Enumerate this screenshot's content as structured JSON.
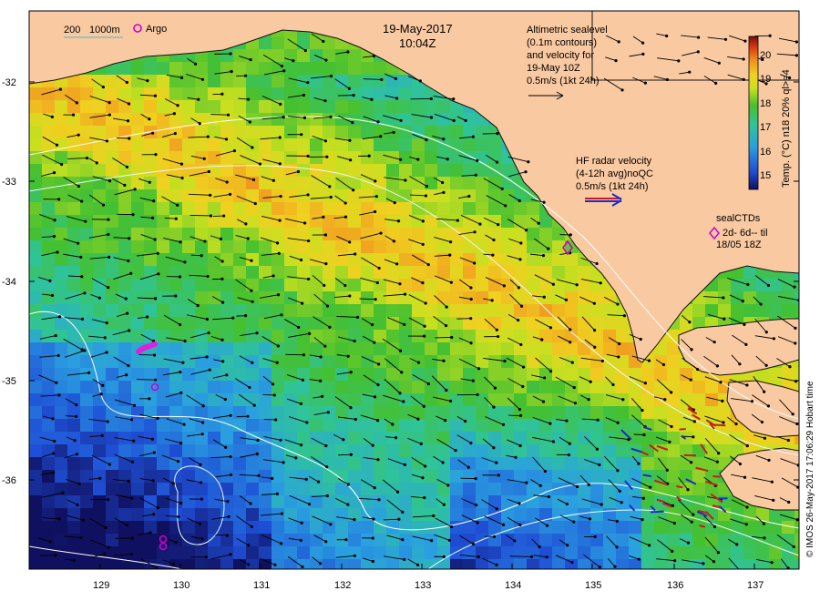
{
  "header": {
    "date": "19-May-2017",
    "time": "10:04Z"
  },
  "legend": {
    "contour_200": "200",
    "contour_1000": "1000m",
    "argo_label": "Argo"
  },
  "altimetry_note": {
    "line1": "Altimetric sealevel",
    "line2": "(0.1m contours)",
    "line3": "and velocity for",
    "line4": "19-May 10Z",
    "line5": "0.5m/s (1kt 24h)"
  },
  "hf_radar_note": {
    "line1": "HF radar velocity",
    "line2": "(4-12h avg)noQC",
    "line3": "0.5m/s (1kt 24h)"
  },
  "seal_note": {
    "line1": "sealCTDs",
    "line2": "2d- 6d-- til",
    "line3": "18/05 18Z"
  },
  "colorbar": {
    "label": "Temp. (°C) n18 20% ql>=4",
    "ticks": [
      "15",
      "16",
      "17",
      "18",
      "19",
      "20"
    ],
    "min": 14.6,
    "max": 20.6
  },
  "axes": {
    "x_ticks": [
      "129",
      "130",
      "131",
      "132",
      "133",
      "134",
      "135",
      "136",
      "137"
    ],
    "y_ticks": [
      "-32",
      "-33",
      "-34",
      "-35",
      "-36"
    ]
  },
  "credit": "© IMOS 26-May-2017 17:06:29 Hobart time",
  "colors": {
    "land": "#f9c9a1",
    "argo": "#cc00cc",
    "hf_radar": "#1a2ccc",
    "hf_radar_alt": "#cc1a1a"
  }
}
